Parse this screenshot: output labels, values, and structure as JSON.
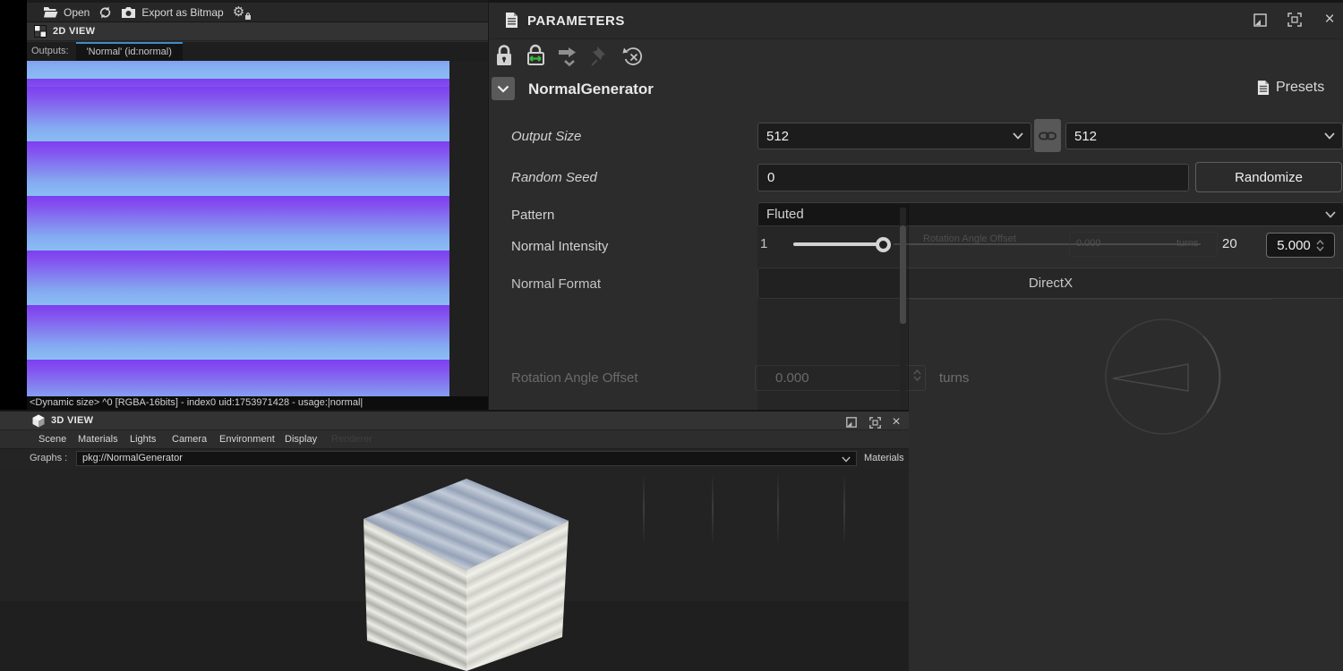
{
  "toolbar": {
    "open_label": "Open",
    "export_label": "Export as Bitmap"
  },
  "view2d": {
    "title": "2D VIEW",
    "outputs_label": "Outputs:",
    "active_tab": "'Normal' (id:normal)",
    "status": "<Dynamic size> ^0 [RGBA-16bits] - index0 uid:1753971428 - usage:|normal|"
  },
  "view3d": {
    "title": "3D VIEW",
    "menu": [
      "Scene",
      "Materials",
      "Lights",
      "Camera",
      "Environment",
      "Display",
      "Renderer"
    ],
    "graphs_label": "Graphs :",
    "graph_value": "pkg://NormalGenerator",
    "materials_label": "Materials"
  },
  "params": {
    "title": "PARAMETERS",
    "presets_label": "Presets",
    "node_title": "NormalGenerator",
    "rows": {
      "output_size": {
        "label": "Output Size",
        "width": "512",
        "height": "512"
      },
      "random_seed": {
        "label": "Random Seed",
        "value": "0",
        "button": "Randomize"
      },
      "pattern": {
        "label": "Pattern",
        "value": "Fluted"
      },
      "normal_intensity": {
        "label": "Normal Intensity",
        "min": "1",
        "max": "20",
        "value": "5.000"
      },
      "normal_format": {
        "label": "Normal Format",
        "value": "DirectX"
      },
      "rotation_angle": {
        "label": "Rotation Angle Offset",
        "value": "0.000",
        "unit": "turns"
      }
    },
    "ghost": {
      "label": "Rotation Angle Offset",
      "value": "0.000",
      "unit": "turns"
    }
  },
  "icons": {
    "gear": "⚙",
    "close": "×"
  },
  "colors": {
    "accent_blue": "#3f8cc8",
    "link_green": "#3cb43c",
    "normal_map_purple": "#7d3ff0",
    "normal_map_blue": "#8abdf4",
    "panel_bg": "#2c2c2c"
  }
}
